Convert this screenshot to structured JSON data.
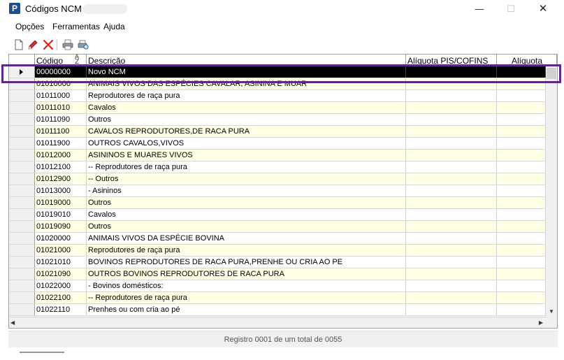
{
  "window": {
    "title": "Códigos NCM -",
    "app_icon_letter": "P",
    "minimize_glyph": "—",
    "maximize_glyph": "☐",
    "close_glyph": "✕"
  },
  "menu": {
    "items": [
      {
        "label": "Opções"
      },
      {
        "label": "Ferramentas"
      },
      {
        "label": "Ajuda"
      }
    ]
  },
  "toolbar": {
    "buttons": [
      {
        "name": "new-document",
        "icon": "document-icon"
      },
      {
        "name": "edit",
        "icon": "pencil-icon"
      },
      {
        "name": "delete",
        "icon": "delete-x-icon"
      },
      {
        "name": "print",
        "icon": "printer-icon"
      },
      {
        "name": "print-preview",
        "icon": "print-preview-icon"
      }
    ]
  },
  "table": {
    "columns": [
      "Código",
      "Descrição",
      "Alíquota PIS/COFINS",
      "Alíquota"
    ],
    "selected_row_index": 0,
    "rows": [
      {
        "code": "00000000",
        "desc": "Novo NCM"
      },
      {
        "code": "01010000",
        "desc": "ANIMAIS VIVOS DAS ESPÉCIES CAVALAR, ASININA E MUAR"
      },
      {
        "code": "01011000",
        "desc": "Reprodutores de raça pura"
      },
      {
        "code": "01011010",
        "desc": "Cavalos"
      },
      {
        "code": "01011090",
        "desc": "Outros"
      },
      {
        "code": "01011100",
        "desc": "CAVALOS REPRODUTORES,DE RACA PURA"
      },
      {
        "code": "01011900",
        "desc": "OUTROS CAVALOS,VIVOS"
      },
      {
        "code": "01012000",
        "desc": "ASININOS E MUARES VIVOS"
      },
      {
        "code": "01012100",
        "desc": "-- Reprodutores de raça pura"
      },
      {
        "code": "01012900",
        "desc": "-- Outros"
      },
      {
        "code": "01013000",
        "desc": "- Asininos"
      },
      {
        "code": "01019000",
        "desc": "Outros"
      },
      {
        "code": "01019010",
        "desc": "Cavalos"
      },
      {
        "code": "01019090",
        "desc": "Outros"
      },
      {
        "code": "01020000",
        "desc": "ANIMAIS VIVOS DA ESPÉCIE BOVINA"
      },
      {
        "code": "01021000",
        "desc": "Reprodutores de raça pura"
      },
      {
        "code": "01021010",
        "desc": "BOVINOS REPRODUTORES DE RACA PURA,PRENHE OU CRIA AO PE"
      },
      {
        "code": "01021090",
        "desc": "OUTROS BOVINOS REPRODUTORES DE RACA PURA"
      },
      {
        "code": "01022000",
        "desc": "- Bovinos domésticos:"
      },
      {
        "code": "01022100",
        "desc": "-- Reprodutores de raça pura"
      },
      {
        "code": "01022110",
        "desc": "Prenhes ou com cria ao pé"
      }
    ]
  },
  "status": {
    "text": "Registro 0001 de um total de 0055"
  },
  "colors": {
    "highlight_border": "#5b2a86",
    "alt_row": "#ffffe6",
    "selected_row": "#000000"
  }
}
